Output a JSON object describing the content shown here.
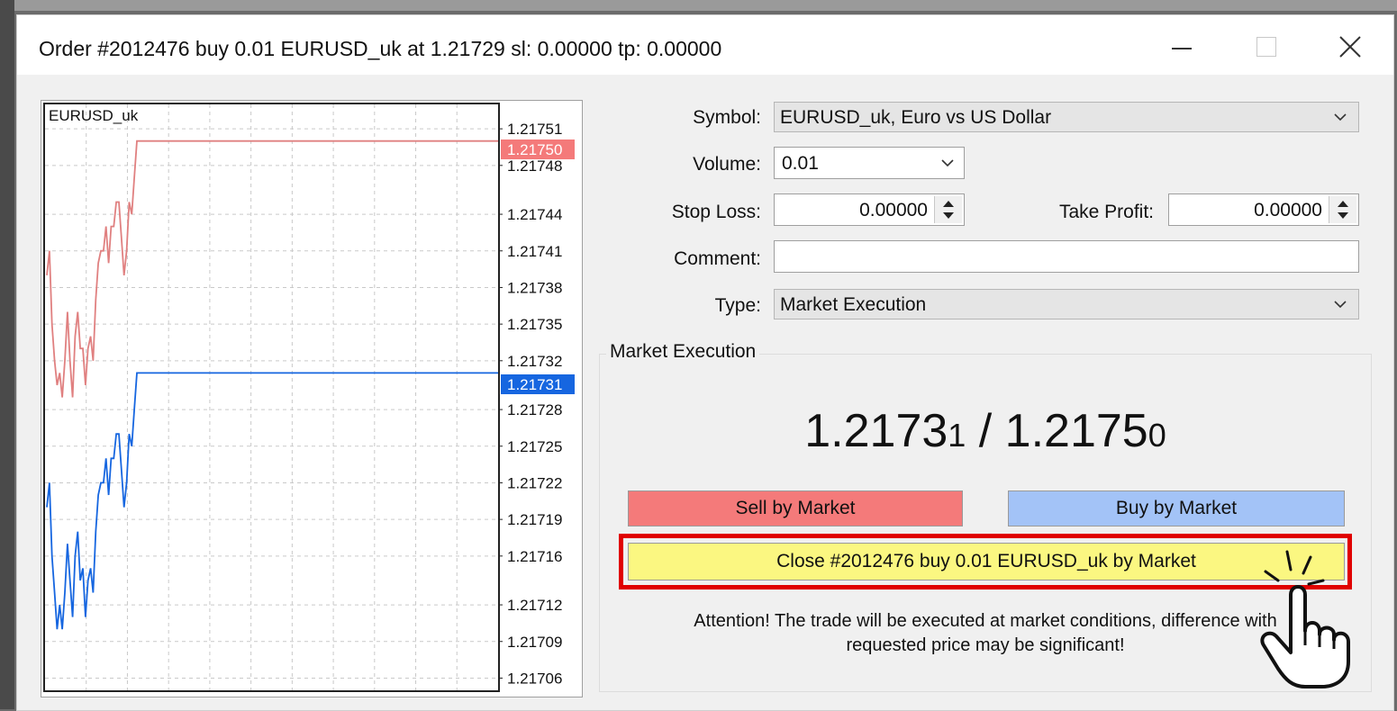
{
  "window": {
    "title": "Order #2012476 buy 0.01 EURUSD_uk at 1.21729 sl: 0.00000 tp: 0.00000"
  },
  "chart": {
    "symbol": "EURUSD_uk",
    "ask_label": "1.21750",
    "bid_label": "1.21731",
    "ask_color": "#f47a7a",
    "bid_color": "#1666e0"
  },
  "chart_data": {
    "type": "line",
    "title": "EURUSD_uk",
    "ylim": [
      1.21705,
      1.21753
    ],
    "y_ticks": [
      "1.21751",
      "1.21748",
      "1.21744",
      "1.21741",
      "1.21738",
      "1.21735",
      "1.21732",
      "1.21728",
      "1.21725",
      "1.21722",
      "1.21719",
      "1.21716",
      "1.21712",
      "1.21709",
      "1.21706"
    ],
    "grid": true,
    "series": [
      {
        "role": "ask",
        "color": "#e08080",
        "values": [
          1.21739,
          1.21741,
          1.21735,
          1.21732,
          1.2173,
          1.21731,
          1.21729,
          1.21732,
          1.21736,
          1.21732,
          1.21729,
          1.21734,
          1.21736,
          1.21733,
          1.21733,
          1.2173,
          1.21733,
          1.21734,
          1.21732,
          1.21737,
          1.2174,
          1.21741,
          1.21741,
          1.21743,
          1.2174,
          1.21743,
          1.21743,
          1.21745,
          1.21745,
          1.21742,
          1.21739,
          1.21741,
          1.21745,
          1.21744,
          1.21747,
          1.2175,
          1.2175,
          1.2175,
          1.2175,
          1.2175,
          1.2175,
          1.2175
        ]
      },
      {
        "role": "bid",
        "color": "#1666e0",
        "values": [
          1.2172,
          1.21722,
          1.21716,
          1.21713,
          1.2171,
          1.21712,
          1.2171,
          1.21713,
          1.21717,
          1.21714,
          1.21711,
          1.21716,
          1.21718,
          1.21714,
          1.21715,
          1.21711,
          1.21714,
          1.21715,
          1.21713,
          1.21718,
          1.21721,
          1.21722,
          1.21722,
          1.21724,
          1.21721,
          1.21724,
          1.21724,
          1.21726,
          1.21726,
          1.21723,
          1.2172,
          1.21722,
          1.21726,
          1.21725,
          1.21728,
          1.21731,
          1.21731,
          1.21731,
          1.21731,
          1.21731,
          1.21731,
          1.21731
        ]
      }
    ]
  },
  "form": {
    "symbol_label": "Symbol:",
    "symbol_value": "EURUSD_uk, Euro vs US Dollar",
    "volume_label": "Volume:",
    "volume_value": "0.01",
    "stop_loss_label": "Stop Loss:",
    "stop_loss_value": "0.00000",
    "take_profit_label": "Take Profit:",
    "take_profit_value": "0.00000",
    "comment_label": "Comment:",
    "comment_value": "",
    "type_label": "Type:",
    "type_value": "Market Execution"
  },
  "market": {
    "group_title": "Market Execution",
    "bid_main": "1.2173",
    "bid_small": "1",
    "separator": " / ",
    "ask_main": "1.2175",
    "ask_small": "0",
    "sell_label": "Sell by Market",
    "buy_label": "Buy by Market",
    "close_label": "Close #2012476 buy 0.01 EURUSD_uk by Market",
    "sell_color": "#f47a7a",
    "buy_color": "#a3c3f7",
    "close_color": "#fbf781",
    "highlight_color": "#e00000",
    "attention_line1": "Attention! The trade will be executed at market conditions, difference with",
    "attention_line2": "requested price may be significant!"
  },
  "icons": {
    "minimize": "minimize-icon",
    "maximize": "maximize-icon",
    "close": "close-icon",
    "chevron": "chevron-down-icon",
    "pointer": "hand-pointer-icon"
  }
}
